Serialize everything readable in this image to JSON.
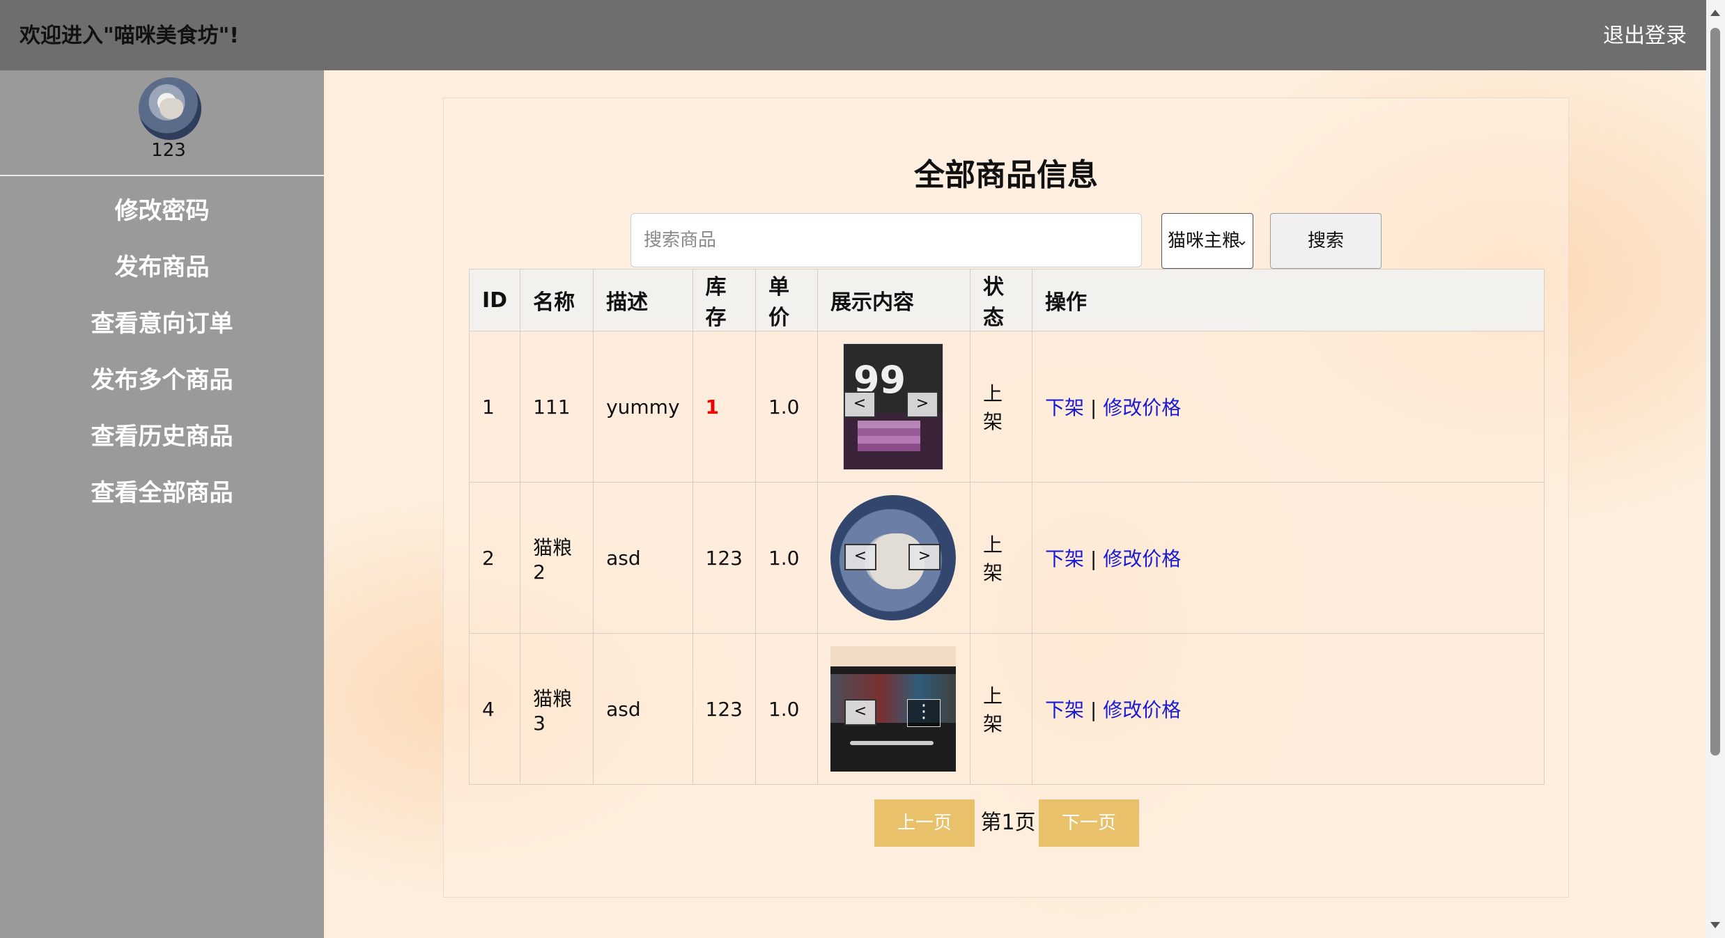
{
  "header": {
    "welcome": "欢迎进入\"喵咪美食坊\"!",
    "logout": "退出登录"
  },
  "sidebar": {
    "username": "123",
    "items": [
      {
        "label": "修改密码"
      },
      {
        "label": "发布商品"
      },
      {
        "label": "查看意向订单"
      },
      {
        "label": "发布多个商品"
      },
      {
        "label": "查看历史商品"
      },
      {
        "label": "查看全部商品"
      }
    ]
  },
  "main": {
    "title": "全部商品信息",
    "search": {
      "placeholder": "搜索商品",
      "value": ""
    },
    "category": {
      "selected": "猫咪主粮"
    },
    "search_button": "搜索",
    "columns": [
      "ID",
      "名称",
      "描述",
      "库存",
      "单价",
      "展示内容",
      "状态",
      "操作"
    ],
    "rows": [
      {
        "id": "1",
        "name": "111",
        "desc": "yummy",
        "stock": "1",
        "price": "1.0",
        "status": "上架",
        "op_off": "下架",
        "op_sep": "|",
        "op_price": "修改价格",
        "media": "product-package-image"
      },
      {
        "id": "2",
        "name": "猫粮2",
        "desc": "asd",
        "stock": "123",
        "price": "1.0",
        "status": "上架",
        "op_off": "下架",
        "op_sep": "|",
        "op_price": "修改价格",
        "media": "cat-photo"
      },
      {
        "id": "4",
        "name": "猫粮3",
        "desc": "asd",
        "stock": "123",
        "price": "1.0",
        "status": "上架",
        "op_off": "下架",
        "op_sep": "|",
        "op_price": "修改价格",
        "media": "video-thumbnail"
      }
    ],
    "media_prev": "<",
    "media_next": ">",
    "video_menu": "⋮",
    "media_food_text": "99",
    "pager": {
      "prev": "上一页",
      "label": "第1页",
      "next": "下一页"
    }
  },
  "colors": {
    "topbar": "#6e6e6e",
    "sidebar": "#9a9a9a",
    "link": "#1a1ad6",
    "stock_low": "#e00000",
    "pager_button": "#e8c16a"
  }
}
